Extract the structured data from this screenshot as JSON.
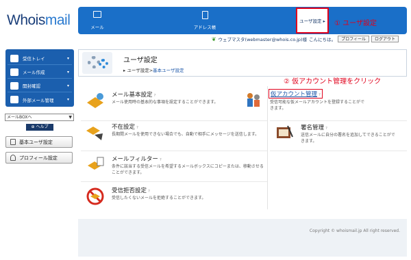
{
  "logo": {
    "part1": "Whois",
    "part2": "mail"
  },
  "topnav": [
    {
      "label": "メール",
      "icon": "mail-icon"
    },
    {
      "label": "アドレス帳",
      "icon": "addressbook-icon"
    },
    {
      "label": "ユーザ設定 ▸",
      "icon": "user-settings-icon"
    }
  ],
  "annotations": {
    "step1": "① ユーザ設定",
    "step2": "② 仮アカウント管理をクリック"
  },
  "userbar": {
    "user": "ウェブマスタ(webmaster@whois.co.jp)様",
    "greeting": "こんにちは。",
    "profile_button": "プロフィール",
    "logout_button": "ログアウト"
  },
  "sidebar": {
    "items": [
      {
        "label": "受信トレイ",
        "icon": "inbox-icon"
      },
      {
        "label": "メール作成",
        "icon": "compose-icon"
      },
      {
        "label": "開封確認",
        "icon": "read-receipt-icon"
      },
      {
        "label": "外部メール管理",
        "icon": "external-mail-icon"
      }
    ],
    "mailbox_select": "メールBOXへ",
    "help_label": "ヘルプ",
    "basic_settings_button": "基本ユーザ設定",
    "profile_settings_button": "プロフィール設定"
  },
  "header": {
    "title": "ユーザ設定",
    "breadcrumb_prefix": "ユーザ設定>",
    "breadcrumb_current": "基本ユーザ設定"
  },
  "cards": {
    "mail_basic": {
      "title": "メール基本設定",
      "desc": "メール使用時の基本的な事項を設定することができます。"
    },
    "absence": {
      "title": "不在設定",
      "desc": "長期間メールを使用できない場合でも、自動で相手にメッセージを送信します。"
    },
    "filter": {
      "title": "メールフィルター",
      "desc": "条件に該当する受信メールを希望するメールボックスにコピーまたは、移動させることができます。"
    },
    "reject": {
      "title": "受信拒否設定",
      "desc": "受信したくないメールを拒絶することができます。"
    },
    "temp_account": {
      "title": "仮アカウント管理",
      "desc": "受信可能な仮メールアカウントを登録することができます。"
    },
    "signature": {
      "title": "署名管理",
      "desc": "送信メールに自分の署名を追加してできることができます。"
    }
  },
  "help_tag": "?",
  "footer": {
    "copyright": "Copyright © whoismail.jp All right reserved."
  }
}
